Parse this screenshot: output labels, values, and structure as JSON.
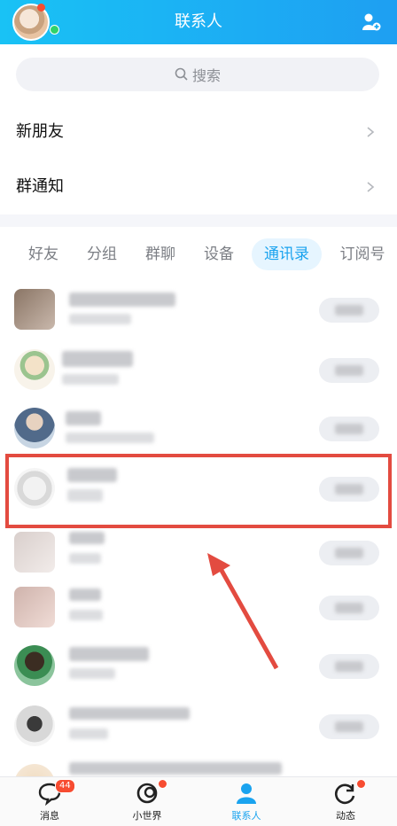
{
  "header": {
    "title": "联系人"
  },
  "search": {
    "placeholder": "搜索"
  },
  "rows": [
    {
      "label": "新朋友"
    },
    {
      "label": "群通知"
    }
  ],
  "tabs": [
    {
      "label": "好友",
      "active": false
    },
    {
      "label": "分组",
      "active": false
    },
    {
      "label": "群聊",
      "active": false
    },
    {
      "label": "设备",
      "active": false
    },
    {
      "label": "通讯录",
      "active": true
    },
    {
      "label": "订阅号",
      "active": false
    }
  ],
  "tabbar": [
    {
      "label": "消息",
      "badge": "44"
    },
    {
      "label": "小世界"
    },
    {
      "label": "联系人"
    },
    {
      "label": "动态"
    }
  ],
  "colors": {
    "primary": "#1aa3ef",
    "highlight": "#e34b40",
    "badge": "#f74c31"
  }
}
